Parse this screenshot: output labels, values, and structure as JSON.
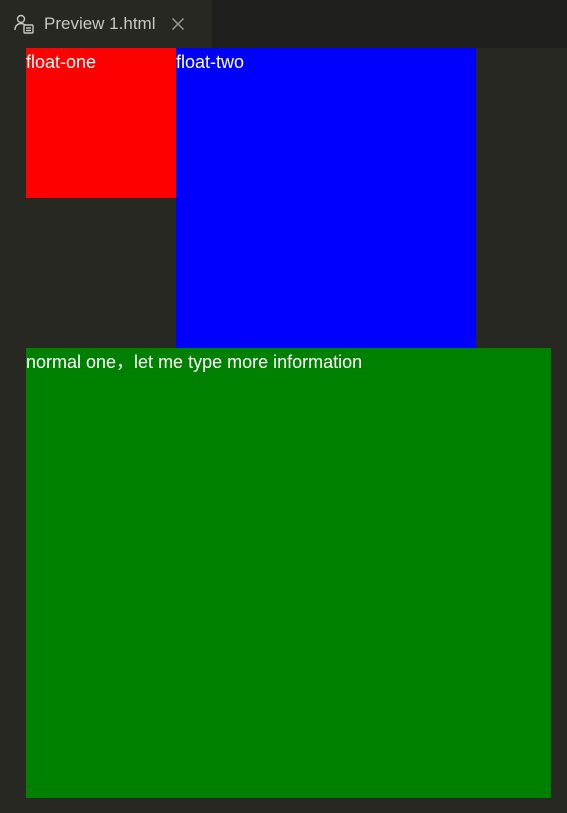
{
  "tab": {
    "title": "Preview 1.html",
    "icon": "preview-icon",
    "close_icon": "close-icon"
  },
  "preview": {
    "float_one": {
      "text": "float-one",
      "color": "#ff0000"
    },
    "float_two": {
      "text": "float-two",
      "color": "#0000ff"
    },
    "normal_one": {
      "text": "normal one，let me type more information",
      "color": "#008000"
    }
  },
  "colors": {
    "editor_bg": "#272822",
    "tabbar_bg": "#1e1f1c",
    "tab_text": "#c8c8c2",
    "box_text": "#ffffff"
  }
}
